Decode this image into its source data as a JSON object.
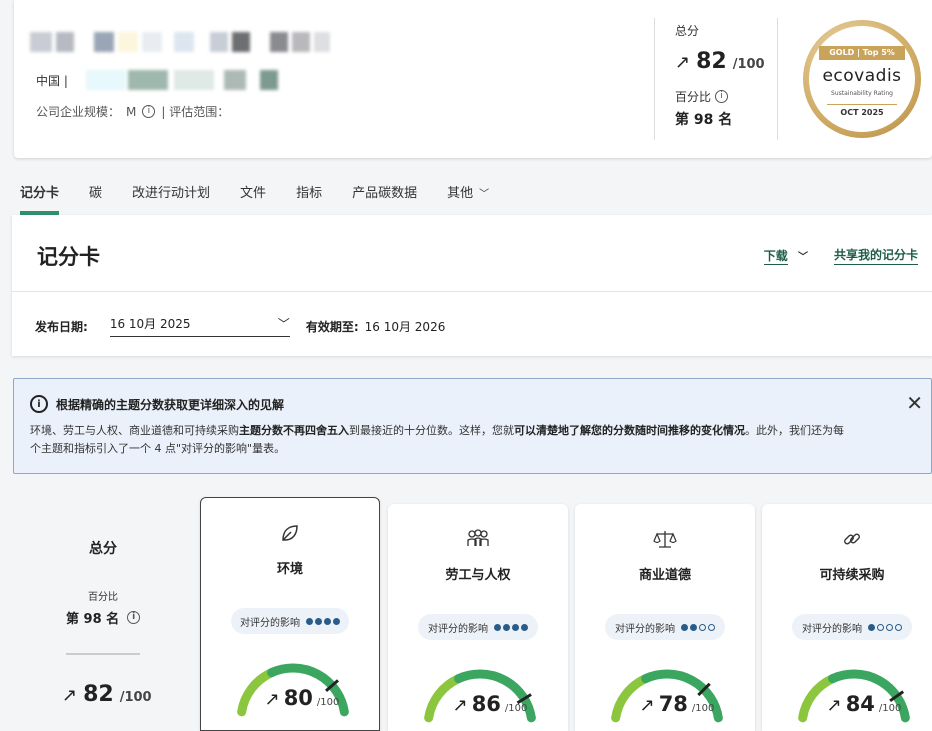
{
  "header": {
    "country": "中国 |",
    "company_size_label": "公司企业规模：",
    "company_size_value": "M",
    "scope_label": "| 评估范围："
  },
  "summary": {
    "total_label": "总分",
    "score": "82",
    "score_den": "/100",
    "percentile_label": "百分比",
    "rank": "第 98 名"
  },
  "medal": {
    "ribbon": "GOLD | Top 5%",
    "brand": "ecovadis",
    "subtitle": "Sustainability Rating",
    "date": "OCT 2025"
  },
  "tabs": [
    {
      "label": "记分卡",
      "active": true
    },
    {
      "label": "碳"
    },
    {
      "label": "改进行动计划"
    },
    {
      "label": "文件"
    },
    {
      "label": "指标"
    },
    {
      "label": "产品碳数据"
    },
    {
      "label": "其他"
    }
  ],
  "scorecard": {
    "title": "记分卡",
    "download": "下载",
    "share": "共享我的记分卡",
    "publish_label": "发布日期:",
    "publish_date": "16 10月 2025",
    "valid_label": "有效期至:",
    "valid_date": "16 10月 2026"
  },
  "banner": {
    "title": "根据精确的主题分数获取更详细深入的见解",
    "body_1": "环境、劳工与人权、商业道德和可持续采购",
    "body_2": "主题分数不再四舍五入",
    "body_3": "到最接近的十分位数。这样，您就",
    "body_4": "可以清楚地了解您的分数随时间推移的变化情况",
    "body_5": "。此外，我们还为每个主题和指标引入了一个 4 点\"对评分的影响\"量表。"
  },
  "overall": {
    "title": "总分",
    "percentile_label": "百分比",
    "rank": "第 98 名",
    "score": "82",
    "score_den": "/100"
  },
  "themes": [
    {
      "name": "环境",
      "icon": "leaf-icon",
      "impact_label": "对评分的影响",
      "impact": 4,
      "score": "80",
      "score_value": 80,
      "den": "/100",
      "selected": true
    },
    {
      "name": "劳工与人权",
      "icon": "people-icon",
      "impact_label": "对评分的影响",
      "impact": 4,
      "score": "86",
      "score_value": 86,
      "den": "/100"
    },
    {
      "name": "商业道德",
      "icon": "scales-icon",
      "impact_label": "对评分的影响",
      "impact": 2,
      "score": "78",
      "score_value": 78,
      "den": "/100"
    },
    {
      "name": "可持续采购",
      "icon": "link-icon",
      "impact_label": "对评分的影响",
      "impact": 1,
      "score": "84",
      "score_value": 84,
      "den": "/100"
    }
  ],
  "colors": {
    "accent": "#2f8f6f",
    "link": "#1e5e48",
    "gauge_green": "#3aa660",
    "gauge_light": "#8cc63f",
    "banner_bg": "#eaf1fa"
  }
}
